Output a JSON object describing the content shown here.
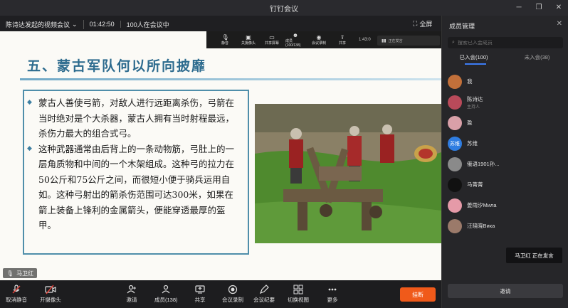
{
  "window": {
    "title": "钉钉会议"
  },
  "meeting": {
    "host_title": "陈诗达发起的视频会议",
    "elapsed": "01:42:50",
    "participants": "100人在会议中",
    "fullscreen_label": "全屏"
  },
  "float_bar": {
    "items": [
      {
        "icon": "microphone-icon",
        "label": "静音"
      },
      {
        "icon": "camera-off-icon",
        "label": "关摄像头"
      },
      {
        "icon": "share-screen-icon",
        "label": "共享屏幕"
      },
      {
        "icon": "members-icon",
        "label": "成员(100/138)"
      },
      {
        "icon": "record-icon",
        "label": "会议录制"
      },
      {
        "icon": "share-icon",
        "label": "共享"
      }
    ],
    "time": "1:43:0",
    "speaking_chip": "正在发言"
  },
  "slide": {
    "heading": "五、蒙古军队何以所向披靡",
    "paragraphs": [
      "蒙古人善使弓箭，对敌人进行远距离杀伤，弓箭在当时绝对是个大杀器，蒙古人拥有当时射程最远，杀伤力最大的组合式弓。",
      "这种武器通常由后背上的一条动物筋，弓肚上的一层角质物和中间的一个木架组成。这种弓的拉力在50公斤和75公斤之间，而很短小便于骑兵运用自如。这种弓射出的箭杀伤范围可达300米，如果在箭上装备上锋利的金属箭头，便能穿透最厚的盔甲。"
    ]
  },
  "speaker_tag": {
    "name": "马卫红"
  },
  "toolbar": {
    "unmute_label": "取消静音",
    "camera_label": "开摄像头",
    "invite_label": "邀请",
    "members_label": "成员(138)",
    "share_label": "共享",
    "record_label": "会议录制",
    "minutes_label": "会议纪要",
    "switch_view_label": "切换视图",
    "more_label": "更多",
    "leave_label": "挂断"
  },
  "panel": {
    "title": "成员管理",
    "search_placeholder": "搜索已入会成员",
    "tabs": [
      "已入会(100)",
      "未入会(38)"
    ],
    "members": [
      {
        "name": "我",
        "role": "",
        "avatar_color": "#c2703a",
        "avatar_text": ""
      },
      {
        "name": "陈诗达",
        "role": "主持人",
        "avatar_color": "#b94a5a",
        "avatar_text": ""
      },
      {
        "name": "盈",
        "role": "",
        "avatar_color": "#d9a0a8",
        "avatar_text": ""
      },
      {
        "name": "苏维",
        "role": "",
        "avatar_color": "#2f7de1",
        "avatar_text": "苏维"
      },
      {
        "name": "俄语1901孙...",
        "role": "",
        "avatar_color": "#8a8a8a",
        "avatar_text": ""
      },
      {
        "name": "马菁菁",
        "role": "",
        "avatar_color": "#111111",
        "avatar_text": ""
      },
      {
        "name": "姜雨汐Мила",
        "role": "",
        "avatar_color": "#e59aa8",
        "avatar_text": ""
      },
      {
        "name": "汪晓晓Вика",
        "role": "",
        "avatar_color": "#9b7a6a",
        "avatar_text": ""
      }
    ],
    "speaking_tooltip": "马卫红   正在发言",
    "invite_label": "邀请"
  }
}
